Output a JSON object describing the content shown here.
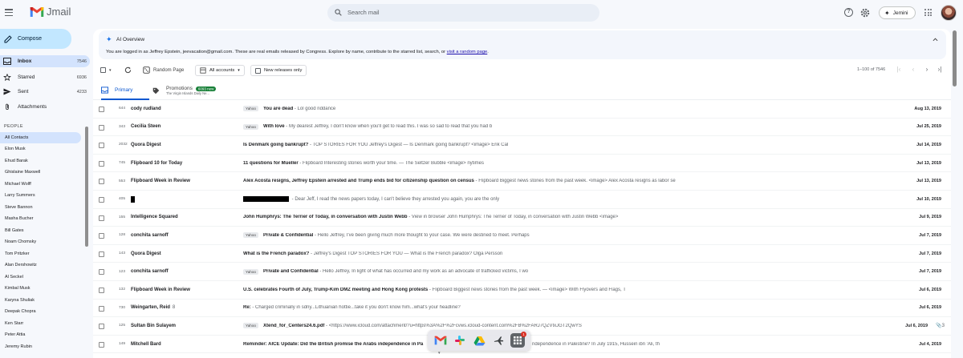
{
  "app": {
    "name": "Jmail"
  },
  "search": {
    "placeholder": "Search mail"
  },
  "header": {
    "jemini_label": "Jemini"
  },
  "compose_label": "Compose",
  "nav": [
    {
      "label": "Inbox",
      "count": "7546",
      "icon": "inbox-icon",
      "active": true
    },
    {
      "label": "Starred",
      "count": "6936",
      "icon": "star-icon",
      "active": false
    },
    {
      "label": "Sent",
      "count": "4233",
      "icon": "send-icon",
      "active": false
    },
    {
      "label": "Attachments",
      "count": "",
      "icon": "paperclip-icon",
      "active": false
    }
  ],
  "people": {
    "header": "PEOPLE",
    "contacts": [
      "All Contacts",
      "Ehud Barak",
      "Ghislaine Maxwell",
      "Michael Wolff",
      "Larry Summers",
      "Steve Bannon",
      "Masha Bucher",
      "Bill Gates",
      "Noam Chomsky",
      "Tom Pritzker",
      "Alan Dershowitz",
      "Al Seckel",
      "Kimbal Musk",
      "Karyna Shuliak",
      "Deepak Chopra",
      "Ken Starr",
      "Peter Attia",
      "Jeremy Rubin"
    ],
    "contacts_top": [
      "Elon Musk"
    ]
  },
  "ai_overview": {
    "title": "AI Overview",
    "text": "You are logged in as Jeffrey Epstein, jeevacation@gmail.com. These are real emails released by Congress. Explore by name, contribute to the starred list, search, or ",
    "link": "visit a random page",
    "text_end": "."
  },
  "toolbar": {
    "random_page": "Random Page",
    "all_accounts": "All accounts",
    "new_releases": "New releases only",
    "pager": "1–100 of 7546"
  },
  "tabs": {
    "primary": "Primary",
    "promotions": "Promotions",
    "promotions_badge": "6093 new",
    "promotions_sub": "The Virgin Islands Daily Ne..."
  },
  "emails": [
    {
      "num": "644",
      "sender": "cody rudland",
      "tag": "Yahoo",
      "subject": "You are dead",
      "snippet": " - Lol good riddance",
      "date": "Aug 13, 2019"
    },
    {
      "num": "343",
      "sender": "Cecilia Steen",
      "tag": "Yahoo",
      "subject": "With love",
      "snippet": " - My dearest Jeffrey, I don't know when you'll get to read this. I was so sad to read that you had b",
      "date": "Jul 25, 2019"
    },
    {
      "num": "2032",
      "sender": "Quora Digest",
      "tag": "",
      "subject": "Is Denmark going bankrupt?",
      "snippet": " - TOP STORIES FOR YOU Jeffrey's Digest — Is Denmark going bankrupt? <image> Erik Cal",
      "date": "Jul 14, 2019"
    },
    {
      "num": "745",
      "sender": "Flipboard 10 for Today",
      "tag": "",
      "subject": "11 questions for Mueller",
      "snippet": " - Flipboard Interesting stories worth your time. — The Seltzer Bubble <image> nytimes",
      "date": "Jul 13, 2019"
    },
    {
      "num": "553",
      "sender": "Flipboard Week in Review",
      "tag": "",
      "subject": "Alex Acosta resigns, Jeffrey Epstein arrested and Trump ends bid for citizenship question on census",
      "snippet": " - Flipboard Biggest news stories from the past week. <image> Alex Acosta resigns as labor se",
      "date": "Jul 13, 2019"
    },
    {
      "num": "405",
      "sender": "",
      "redacted": true,
      "tag": "",
      "subject": "",
      "snippet": " - Dear Jeff, I read the news papers today, I can't believe they arrested you again, you are the only",
      "date": "Jul 10, 2019"
    },
    {
      "num": "155",
      "sender": "Intelligence Squared",
      "tag": "",
      "subject": "John Humphrys: The Terrier of Today, in conversation with Justin Webb",
      "snippet": " - View in browser John Humphrys: The Terrier of Today, in conversation with Justin Webb <image>",
      "date": "Jul 9, 2019"
    },
    {
      "num": "128",
      "sender": "conchita sarnoff",
      "tag": "Yahoo",
      "subject": "Private & Confidential",
      "snippet": " - Hello Jeffrey, I've been giving much more thought to your case. We were destined to meet. Perhaps",
      "date": "Jul 7, 2019"
    },
    {
      "num": "143",
      "sender": "Quora Digest",
      "tag": "",
      "subject": "What is the French paradox?",
      "snippet": " - Jeffrey's Digest TOP STORIES FOR YOU — What is the French paradox? Olga Persson",
      "date": "Jul 7, 2019"
    },
    {
      "num": "123",
      "sender": "conchita sarnoff",
      "tag": "Yahoo",
      "subject": "Private and Confidential",
      "snippet": " - Hello Jeffrey, In light of what has occurred and my work as an advocate of trafficked victims, I wo",
      "date": "Jul 7, 2019"
    },
    {
      "num": "132",
      "sender": "Flipboard Week in Review",
      "tag": "",
      "subject": "U.S. celebrates Fourth of July, Trump-Kim DMZ meeting and Hong Kong protests",
      "snippet": " - Flipboard Biggest news stories from the past week. — <image> With Flyovers and Flags, T",
      "date": "Jul 6, 2019"
    },
    {
      "num": "730",
      "sender": "Weingarten, Reid",
      "sender_note": "8",
      "tag": "",
      "subject": "Re:",
      "snippet": " - Charged criminally in sdny...Lithuanian hottie...take it you don't know him...what's your headline?",
      "date": "Jul 6, 2019"
    },
    {
      "num": "125",
      "sender": "Sultan Bin Sulayem",
      "tag": "Yahoo",
      "subject": "Xtend_for_Centers24.6.pdf",
      "snippet": " - <https://www.icloud.com/attachment/?u=https%3A%2F%2Fcvws.icloud-content.com%2FB%2FARJ7QZVIxJGT2QwYS",
      "date": "Jul 6, 2019",
      "attachments": "3"
    },
    {
      "num": "149",
      "sender": "Mitchell Bard",
      "tag": "",
      "subject": "Reminder: AICE Update: Did the British promise the Arabs independence in Pa",
      "snippet": "lestine?",
      "snippet_tail": "ndependence in Palestine? In July 1915, Hussein ibn 'Ali, th",
      "date": "Jul 4, 2019"
    }
  ],
  "dock": [
    {
      "name": "gmail-icon"
    },
    {
      "name": "slack-icon"
    },
    {
      "name": "drive-icon"
    },
    {
      "name": "flights-icon"
    },
    {
      "name": "apps-grid-icon",
      "badge": "1"
    }
  ],
  "colors": {
    "accent": "#0b57d0",
    "compose_bg": "#c2e7ff",
    "active_nav": "#d3e3fd",
    "promo_badge": "#188038"
  }
}
